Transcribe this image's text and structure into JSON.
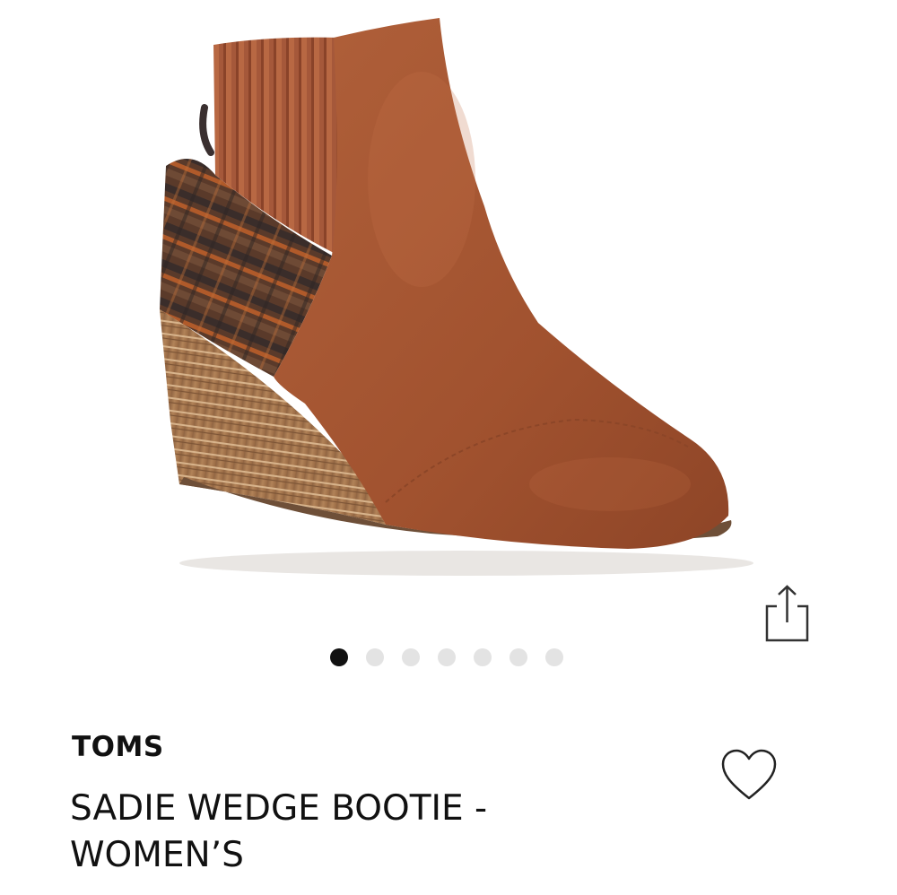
{
  "product": {
    "brand": "TOMS",
    "title": "SADIE WEDGE BOOTIE - WOMEN’S"
  },
  "gallery": {
    "image_count": 7,
    "active_index": 0
  },
  "icons": {
    "share": "share-icon",
    "favorite": "heart-outline-icon"
  },
  "colors": {
    "suede": "#a55733",
    "wedge": "#a7784f",
    "active_dot": "#111111",
    "inactive_dot": "#e3e3e3"
  }
}
